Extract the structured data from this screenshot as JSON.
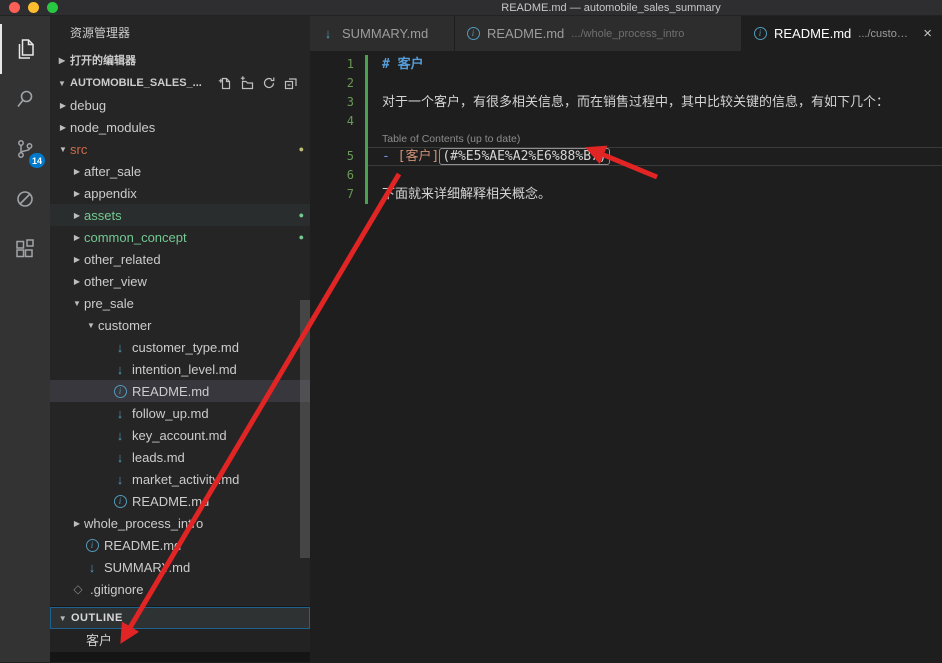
{
  "window": {
    "title": "README.md — automobile_sales_summary"
  },
  "colors": {
    "accent_blue": "#007acc",
    "annotation_red": "#e12424",
    "icon_blue": "#519aba",
    "folder_modified": "#cc6b49",
    "dot_modified": "#bdbd74",
    "dot_untracked": "#73c991",
    "line_number": "#6a9955",
    "gutter_added": "#4aa14f",
    "md_heading": "#569cd6",
    "md_link_text": "#ce9178",
    "md_list_punct": "#6796e6"
  },
  "activity_bar": {
    "items": [
      {
        "id": "explorer",
        "active": true
      },
      {
        "id": "search",
        "active": false
      },
      {
        "id": "source-control",
        "active": false,
        "badge": "14"
      },
      {
        "id": "debug",
        "active": false
      },
      {
        "id": "extensions",
        "active": false
      }
    ]
  },
  "sidebar": {
    "title": "资源管理器",
    "open_editors": {
      "label": "打开的编辑器"
    },
    "folder_section": {
      "label": "AUTOMOBILE_SALES_..."
    },
    "tree": [
      {
        "label": "debug",
        "level": 1,
        "arrow": "collapsed"
      },
      {
        "label": "node_modules",
        "level": 1,
        "arrow": "collapsed"
      },
      {
        "label": "src",
        "level": 1,
        "arrow": "expanded",
        "color": "modified",
        "dot": "modified"
      },
      {
        "label": "after_sale",
        "level": 2,
        "arrow": "collapsed"
      },
      {
        "label": "appendix",
        "level": 2,
        "arrow": "collapsed"
      },
      {
        "label": "assets",
        "level": 2,
        "arrow": "collapsed",
        "color": "untracked",
        "dot": "untracked",
        "highlight": true
      },
      {
        "label": "common_concept",
        "level": 2,
        "arrow": "collapsed",
        "color": "untracked",
        "dot": "untracked"
      },
      {
        "label": "other_related",
        "level": 2,
        "arrow": "collapsed"
      },
      {
        "label": "other_view",
        "level": 2,
        "arrow": "collapsed"
      },
      {
        "label": "pre_sale",
        "level": 2,
        "arrow": "expanded"
      },
      {
        "label": "customer",
        "level": 3,
        "arrow": "expanded"
      },
      {
        "label": "customer_type.md",
        "level": 4,
        "icon": "markdown"
      },
      {
        "label": "intention_level.md",
        "level": 4,
        "icon": "markdown"
      },
      {
        "label": "README.md",
        "level": 4,
        "icon": "info",
        "selected": true
      },
      {
        "label": "follow_up.md",
        "level": 4,
        "icon": "markdown"
      },
      {
        "label": "key_account.md",
        "level": 4,
        "icon": "markdown"
      },
      {
        "label": "leads.md",
        "level": 4,
        "icon": "markdown"
      },
      {
        "label": "market_activity.md",
        "level": 4,
        "icon": "markdown"
      },
      {
        "label": "README.md",
        "level": 4,
        "icon": "info"
      },
      {
        "label": "whole_process_intro",
        "level": 2,
        "arrow": "collapsed"
      },
      {
        "label": "README.md",
        "level": 2,
        "icon": "info"
      },
      {
        "label": "SUMMARY.md",
        "level": 2,
        "icon": "markdown"
      },
      {
        "label": ".gitignore",
        "level": 1,
        "icon": "gitignore"
      }
    ],
    "outline": {
      "label": "OUTLINE",
      "items": [
        {
          "label": "客户"
        }
      ]
    }
  },
  "editor": {
    "tabs": [
      {
        "title": "SUMMARY.md",
        "description": "",
        "icon": "markdown",
        "active": false
      },
      {
        "title": "README.md",
        "description": ".../whole_process_intro",
        "icon": "info",
        "active": false
      },
      {
        "title": "README.md",
        "description": ".../customer",
        "icon": "info",
        "active": true
      }
    ],
    "close_glyph": "×",
    "lines": [
      {
        "num": "1",
        "segments": [
          {
            "text": "# 客户",
            "style": "heading"
          }
        ]
      },
      {
        "num": "2",
        "segments": []
      },
      {
        "num": "3",
        "segments": [
          {
            "text": "对于一个客户，有很多相关信息，而在销售过程中，其中比较关键的信息，有如下几个：",
            "style": "plain"
          }
        ]
      },
      {
        "num": "4",
        "segments": []
      },
      {
        "type": "codelens",
        "text": "Table of Contents (up to date)"
      },
      {
        "num": "5",
        "current": true,
        "segments": [
          {
            "text": "- ",
            "style": "list-punct"
          },
          {
            "text": "[客户]",
            "style": "link-text"
          },
          {
            "text": "(#%E5%AE%A2%E6%88%B7)",
            "style": "link-url-boxed"
          }
        ]
      },
      {
        "num": "6",
        "segments": []
      },
      {
        "num": "7",
        "segments": [
          {
            "text": "下面就来详细解释相关概念。",
            "style": "plain"
          }
        ]
      }
    ]
  }
}
